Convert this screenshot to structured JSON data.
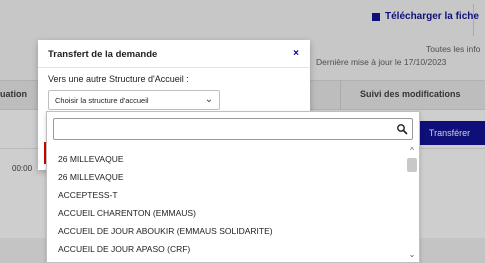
{
  "background": {
    "download_label": "Télécharger la fiche",
    "toutes_text": "Toutes les info",
    "derniere_text": "Dernière mise à jour le 17/10/2023",
    "tab_left_label": "uation",
    "tab_suivi_label": "Suivi des modifications",
    "time_text": "00:00",
    "transferer_label": "Transférer"
  },
  "modal": {
    "title": "Transfert de la demande",
    "close_glyph": "×",
    "field_label": "Vers une autre Structure d'Accueil :",
    "select_value": "Choisir la structure d'accueil",
    "select_chevron": "⌄"
  },
  "dropdown": {
    "search_value": "",
    "items": [
      "26 MILLEVAQUE",
      "26 MILLEVAQUE",
      "ACCEPTESS-T",
      "ACCUEIL CHARENTON (EMMAUS)",
      "ACCUEIL DE JOUR ABOUKIR (EMMAUS SOLIDARITE)",
      "ACCUEIL DE JOUR APASO (CRF)"
    ],
    "scroll_up_glyph": "^",
    "scroll_down_glyph": "⌄"
  },
  "colors": {
    "primary": "#000091",
    "error_red": "#ce0500"
  }
}
